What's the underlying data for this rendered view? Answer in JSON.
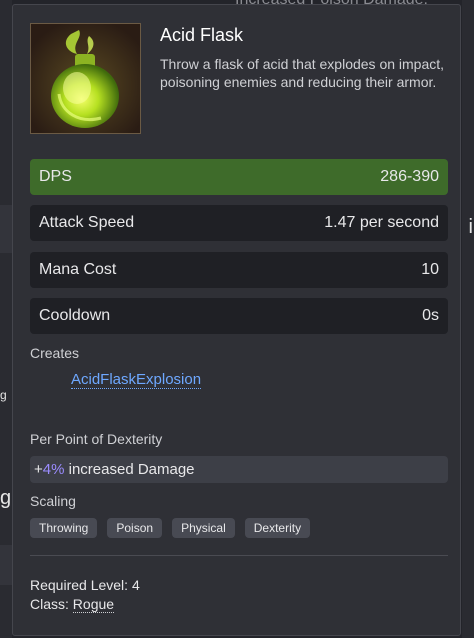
{
  "background": {
    "top_text": "Increased Poison Damage:",
    "left_glyph_1": "g",
    "left_glyph_2": "g",
    "right_glyph": "i"
  },
  "skill": {
    "name": "Acid Flask",
    "description": "Throw a flask of acid that explodes on impact, poisoning enemies and reducing their armor.",
    "icon": "acid-flask-icon"
  },
  "stats": [
    {
      "label": "DPS",
      "value": "286-390"
    },
    {
      "label": "Attack Speed",
      "value": "1.47 per second"
    },
    {
      "label": "Mana Cost",
      "value": "10"
    },
    {
      "label": "Cooldown",
      "value": "0s"
    }
  ],
  "creates": {
    "label": "Creates",
    "link": "AcidFlaskExplosion"
  },
  "dexterity": {
    "label": "Per Point of Dexterity",
    "prefix": "+",
    "percent": "4%",
    "text": " increased Damage"
  },
  "scaling": {
    "label": "Scaling",
    "tags": [
      "Throwing",
      "Poison",
      "Physical",
      "Dexterity"
    ]
  },
  "requirements": {
    "level_label": "Required Level:",
    "level": "4",
    "class_label": "Class:",
    "class": "Rogue"
  },
  "colors": {
    "dps_row": "#3e6b2a",
    "link": "#6ea8ff",
    "percent": "#9b8cff"
  }
}
